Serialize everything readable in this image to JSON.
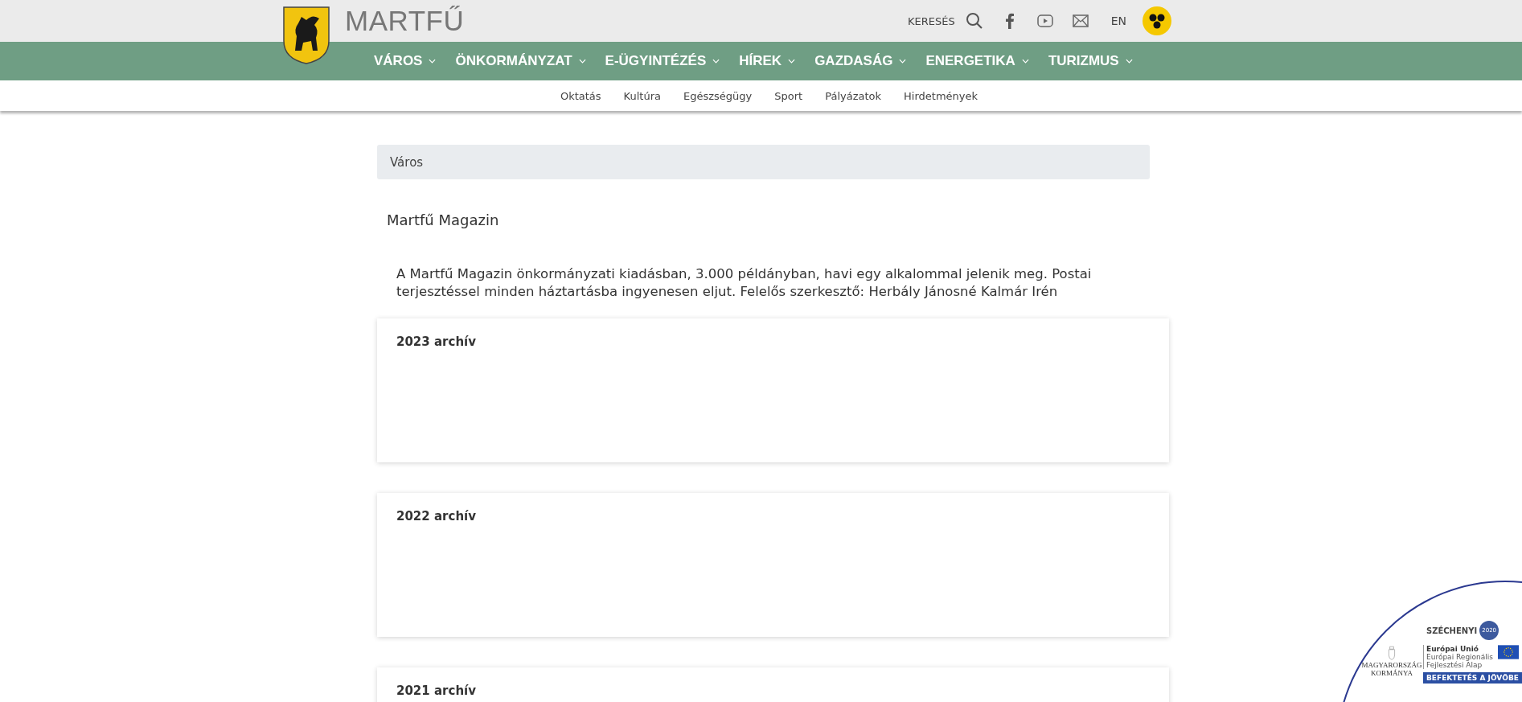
{
  "header": {
    "site_name": "MARTFŰ",
    "search_label": "KERESÉS",
    "language": "EN"
  },
  "main_nav": [
    {
      "label": "VÁROS"
    },
    {
      "label": "ÖNKORMÁNYZAT"
    },
    {
      "label": "E-ÜGYINTÉZÉS"
    },
    {
      "label": "HÍREK"
    },
    {
      "label": "GAZDASÁG"
    },
    {
      "label": "ENERGETIKA"
    },
    {
      "label": "TURIZMUS"
    }
  ],
  "sub_nav": [
    "Oktatás",
    "Kultúra",
    "Egészségügy",
    "Sport",
    "Pályázatok",
    "Hirdetmények"
  ],
  "breadcrumb": "Város",
  "page_title": "Martfű Magazin",
  "intro": "A Martfű Magazin önkormányzati kiadásban, 3.000 példányban, havi egy alkalommal jelenik meg. Postai terjesztéssel minden háztartásba ingyenesen eljut. Felelős szerkesztő: Herbály Jánosné Kalmár Irén",
  "archives": [
    {
      "title": "2023 archív"
    },
    {
      "title": "2022 archív"
    },
    {
      "title": "2021 archív"
    }
  ],
  "funding_badge": {
    "program": "SZÉCHENYI",
    "year": "2020",
    "government": "MAGYARORSZÁG KORMÁNYA",
    "eu_lines": [
      "Európai Unió",
      "Európai Regionális",
      "Fejlesztési Alap"
    ],
    "slogan": "BEFEKTETÉS A JÖVŐBE"
  }
}
